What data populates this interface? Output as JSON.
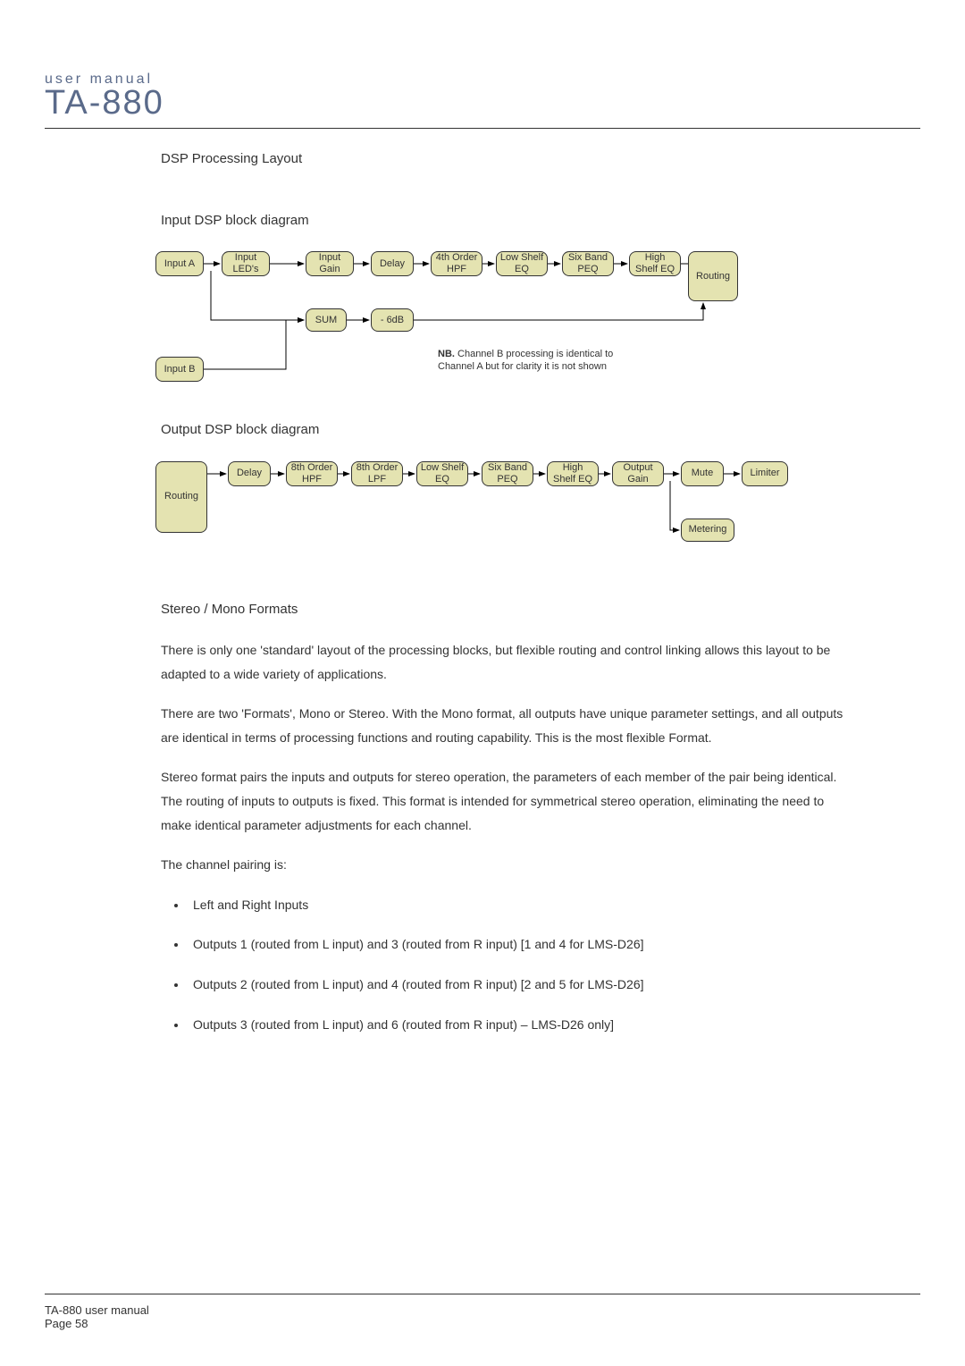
{
  "header": {
    "small": "user manual",
    "big": "TA-880"
  },
  "titles": {
    "dsp_layout": "DSP Processing Layout",
    "input_diag": "Input DSP block diagram",
    "output_diag": "Output DSP block diagram",
    "formats": "Stereo / Mono Formats"
  },
  "input_blocks": {
    "in_a": "Input A",
    "in_leds": "Input LED's",
    "in_gain": "Input Gain",
    "delay": "Delay",
    "hpf": "4th Order HPF",
    "low_shelf": "Low Shelf EQ",
    "peq": "Six Band PEQ",
    "high_shelf": "High Shelf EQ",
    "routing": "Routing",
    "sum": "SUM",
    "m6db": "- 6dB",
    "in_b": "Input B"
  },
  "output_blocks": {
    "routing": "Routing",
    "delay": "Delay",
    "hpf": "8th Order HPF",
    "lpf": "8th Order LPF",
    "low_shelf": "Low Shelf EQ",
    "peq": "Six Band PEQ",
    "high_shelf": "High Shelf EQ",
    "gain": "Output Gain",
    "mute": "Mute",
    "limiter": "Limiter",
    "metering": "Metering"
  },
  "note": {
    "nb": "NB.",
    "text": " Channel B processing is identical to Channel A but for clarity it is not shown"
  },
  "paras": {
    "p1": "There is only one 'standard' layout of the processing blocks, but flexible routing and control linking allows this layout to be adapted to a wide variety of applications.",
    "p2": "There are two 'Formats', Mono or Stereo. With the Mono format, all outputs have unique parameter settings, and all outputs are identical in terms of processing functions and routing capability. This is the most flexible Format.",
    "p3": "Stereo format pairs the inputs and outputs for stereo operation, the parameters of each member of the pair being identical. The routing of inputs to outputs is fixed. This format is intended for symmetrical stereo operation, eliminating the need to make identical parameter adjustments for each channel.",
    "p4": "The channel pairing is:"
  },
  "bullets": {
    "b1": "Left and Right Inputs",
    "b2": "Outputs 1 (routed from L input) and 3 (routed from R input) [1 and 4 for LMS-D26]",
    "b3": "Outputs 2 (routed from L input) and 4 (routed from R input) [2 and 5 for LMS-D26]",
    "b4": "Outputs 3 (routed from L input) and 6 (routed from R input) – LMS-D26 only]"
  },
  "footer": {
    "line1": "TA-880 user manual",
    "line2": "Page 58"
  },
  "chart_data": [
    {
      "type": "block-diagram",
      "name": "Input DSP block diagram",
      "nodes": [
        "Input A",
        "Input LED's",
        "Input Gain",
        "Delay",
        "4th Order HPF",
        "Low Shelf EQ",
        "Six Band PEQ",
        "High Shelf EQ",
        "Routing",
        "SUM",
        "- 6dB",
        "Input B"
      ],
      "edges": [
        [
          "Input A",
          "Input LED's"
        ],
        [
          "Input LED's",
          "Input Gain"
        ],
        [
          "Input Gain",
          "Delay"
        ],
        [
          "Delay",
          "4th Order HPF"
        ],
        [
          "4th Order HPF",
          "Low Shelf EQ"
        ],
        [
          "Low Shelf EQ",
          "Six Band PEQ"
        ],
        [
          "Six Band PEQ",
          "High Shelf EQ"
        ],
        [
          "High Shelf EQ",
          "Routing"
        ],
        [
          "Input A",
          "SUM"
        ],
        [
          "SUM",
          "- 6dB"
        ],
        [
          "- 6dB",
          "Routing"
        ],
        [
          "Input B",
          "SUM"
        ]
      ],
      "annotation": "NB. Channel B processing is identical to Channel A but for clarity it is not shown"
    },
    {
      "type": "block-diagram",
      "name": "Output DSP block diagram",
      "nodes": [
        "Routing",
        "Delay",
        "8th Order HPF",
        "8th Order LPF",
        "Low Shelf EQ",
        "Six Band PEQ",
        "High Shelf EQ",
        "Output Gain",
        "Mute",
        "Limiter",
        "Metering"
      ],
      "edges": [
        [
          "Routing",
          "Delay"
        ],
        [
          "Delay",
          "8th Order HPF"
        ],
        [
          "8th Order HPF",
          "8th Order LPF"
        ],
        [
          "8th Order LPF",
          "Low Shelf EQ"
        ],
        [
          "Low Shelf EQ",
          "Six Band PEQ"
        ],
        [
          "Six Band PEQ",
          "High Shelf EQ"
        ],
        [
          "High Shelf EQ",
          "Output Gain"
        ],
        [
          "Output Gain",
          "Mute"
        ],
        [
          "Mute",
          "Limiter"
        ],
        [
          "Output Gain",
          "Metering"
        ]
      ]
    }
  ]
}
